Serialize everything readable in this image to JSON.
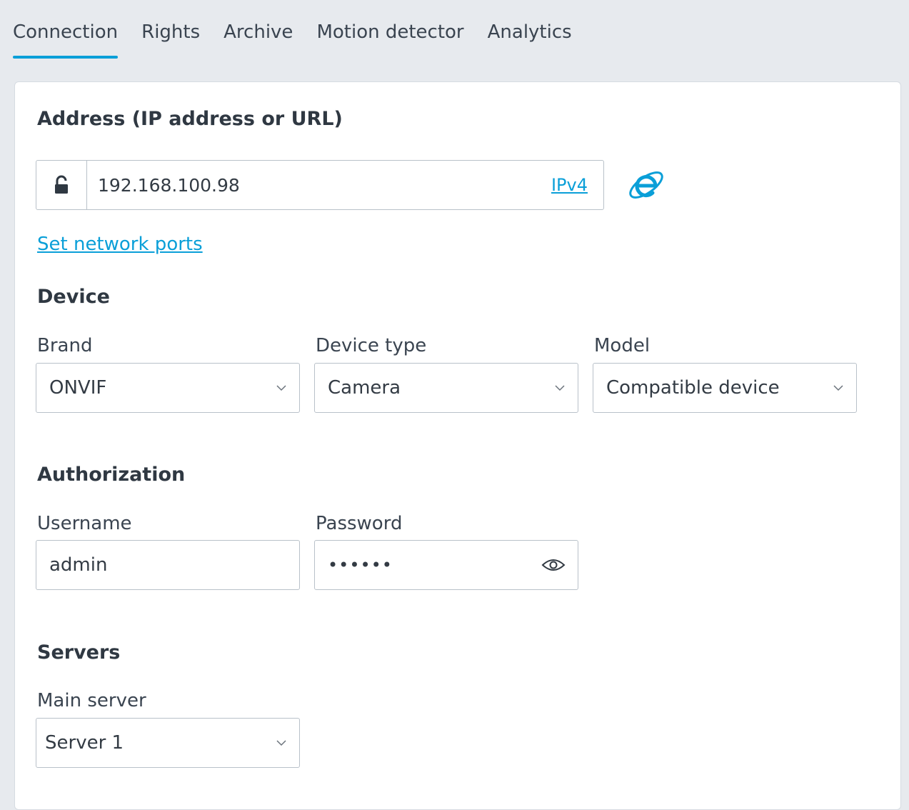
{
  "tabs": [
    {
      "label": "Connection",
      "active": true
    },
    {
      "label": "Rights",
      "active": false
    },
    {
      "label": "Archive",
      "active": false
    },
    {
      "label": "Motion detector",
      "active": false
    },
    {
      "label": "Analytics",
      "active": false
    }
  ],
  "address": {
    "heading": "Address (IP address or URL)",
    "value": "192.168.100.98",
    "protocol_link": "IPv4",
    "lock_icon": "unlock-icon",
    "browser_icon": "internet-explorer-icon"
  },
  "set_ports_link": "Set network ports",
  "device": {
    "heading": "Device",
    "brand": {
      "label": "Brand",
      "value": "ONVIF"
    },
    "device_type": {
      "label": "Device type",
      "value": "Camera"
    },
    "model": {
      "label": "Model",
      "value": "Compatible device"
    }
  },
  "authorization": {
    "heading": "Authorization",
    "username": {
      "label": "Username",
      "value": "admin"
    },
    "password": {
      "label": "Password",
      "value": "••••••",
      "reveal_icon": "eye-icon"
    }
  },
  "servers": {
    "heading": "Servers",
    "main_server": {
      "label": "Main server",
      "value": "Server 1"
    }
  },
  "colors": {
    "accent": "#0a9fd8",
    "background": "#e7eaee",
    "panel": "#ffffff",
    "border": "#b9c1c9"
  }
}
